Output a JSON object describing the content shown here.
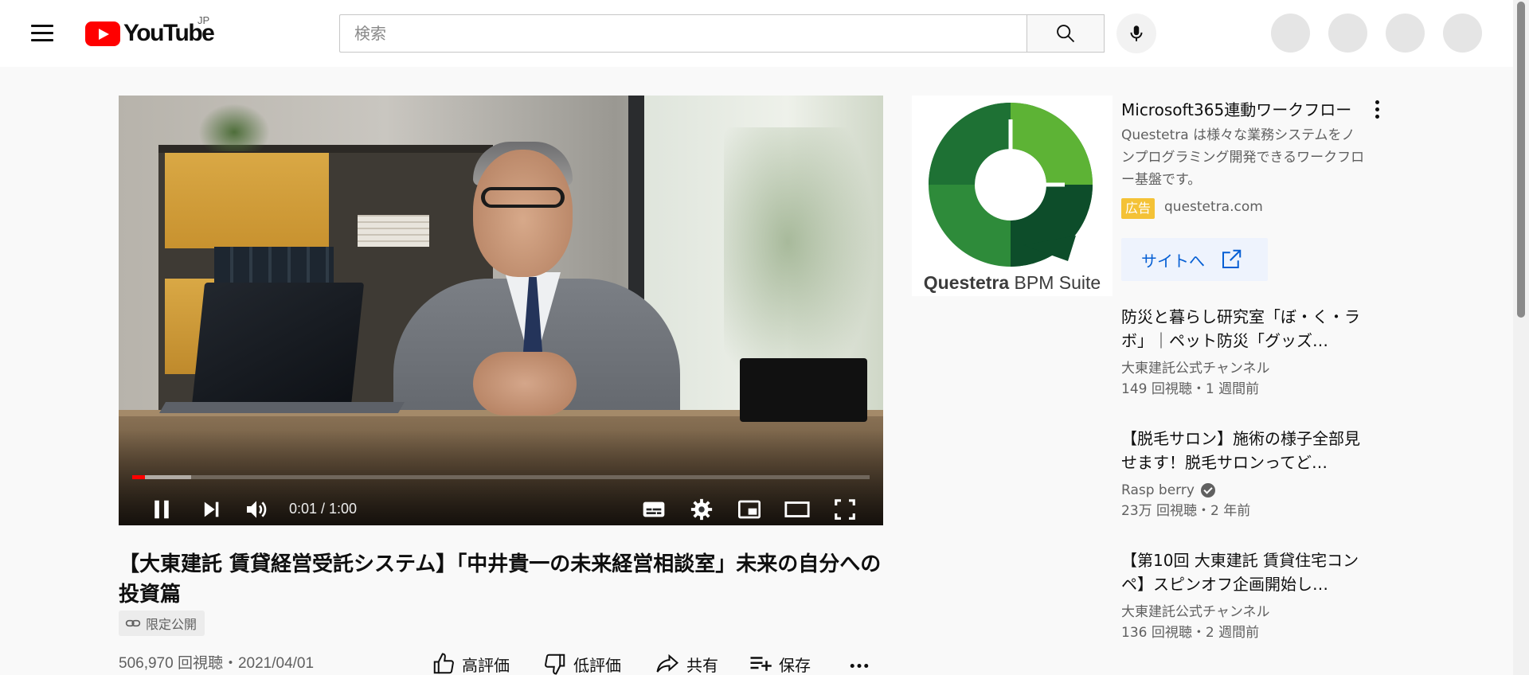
{
  "masthead": {
    "logo_text": "YouTube",
    "region": "JP",
    "search_placeholder": "検索"
  },
  "player": {
    "time_display": "0:01 / 1:00",
    "progress_fraction": 0.017,
    "buffer_fraction": 0.08
  },
  "video": {
    "title": "【大東建託 賃貸経営受託システム】「中井貴一の未来経営相談室」未来の自分への投資篇",
    "privacy_badge": "限定公開",
    "views_date": "506,970 回視聴・2021/04/01",
    "actions": {
      "like": "高評価",
      "dislike": "低評価",
      "share": "共有",
      "save": "保存"
    }
  },
  "ad": {
    "logo_brand": "Questetra",
    "logo_suffix": "BPM Suite",
    "title": "Microsoft365連動ワークフロー",
    "description": "Questetra は様々な業務システムをノンプログラミング開発できるワークフロー基盤です。",
    "label": "広告",
    "domain": "questetra.com",
    "button_label": "サイトへ"
  },
  "recommendations": [
    {
      "title": "防災と暮らし研究室「ぼ・く・ラボ」｜ペット防災「グッズ…",
      "channel": "大東建託公式チャンネル",
      "stats": "149 回視聴・1 週間前",
      "verified": false
    },
    {
      "title": "【脱毛サロン】施術の様子全部見せます！脱毛サロンってど…",
      "channel": "Rasp berry",
      "stats": "23万 回視聴・2 年前",
      "verified": true
    },
    {
      "title": "【第10回 大東建託 賃貸住宅コンペ】スピンオフ企画開始し…",
      "channel": "大東建託公式チャンネル",
      "stats": "136 回視聴・2 週間前",
      "verified": false
    }
  ]
}
